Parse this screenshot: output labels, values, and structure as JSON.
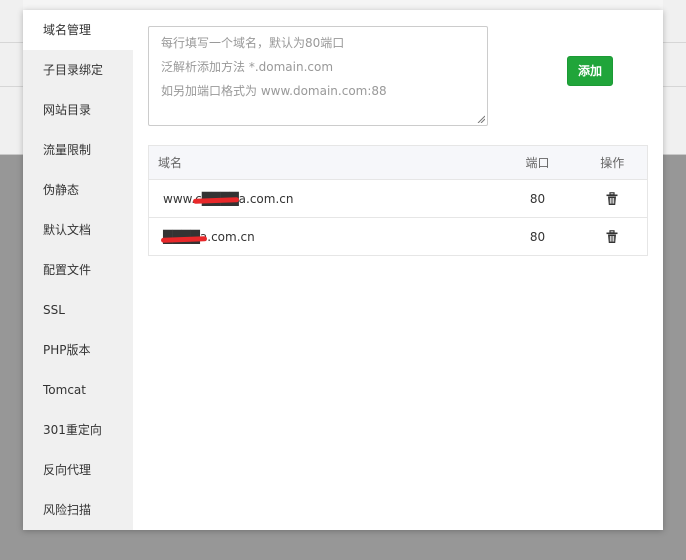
{
  "nav": {
    "items": [
      {
        "label": "域名管理",
        "active": true
      },
      {
        "label": "子目录绑定",
        "active": false
      },
      {
        "label": "网站目录",
        "active": false
      },
      {
        "label": "流量限制",
        "active": false
      },
      {
        "label": "伪静态",
        "active": false
      },
      {
        "label": "默认文档",
        "active": false
      },
      {
        "label": "配置文件",
        "active": false
      },
      {
        "label": "SSL",
        "active": false
      },
      {
        "label": "PHP版本",
        "active": false
      },
      {
        "label": "Tomcat",
        "active": false
      },
      {
        "label": "301重定向",
        "active": false
      },
      {
        "label": "反向代理",
        "active": false
      },
      {
        "label": "风险扫描",
        "active": false
      }
    ]
  },
  "domain_input": {
    "value": "",
    "placeholder_lines": [
      "每行填写一个域名，默认为80端口",
      "泛解析添加方法 *.domain.com",
      "如另加端口格式为 www.domain.com:88"
    ]
  },
  "add_button": {
    "label": "添加"
  },
  "table": {
    "headers": {
      "domain": "域名",
      "port": "端口",
      "action": "操作"
    },
    "rows": [
      {
        "domain": "www.c████a.com.cn",
        "port": "80"
      },
      {
        "domain": "████a.com.cn",
        "port": "80"
      }
    ]
  },
  "colors": {
    "accent_green": "#20a53a",
    "sidebar_bg": "#f0f0f0",
    "redaction_red": "#e8282a"
  }
}
